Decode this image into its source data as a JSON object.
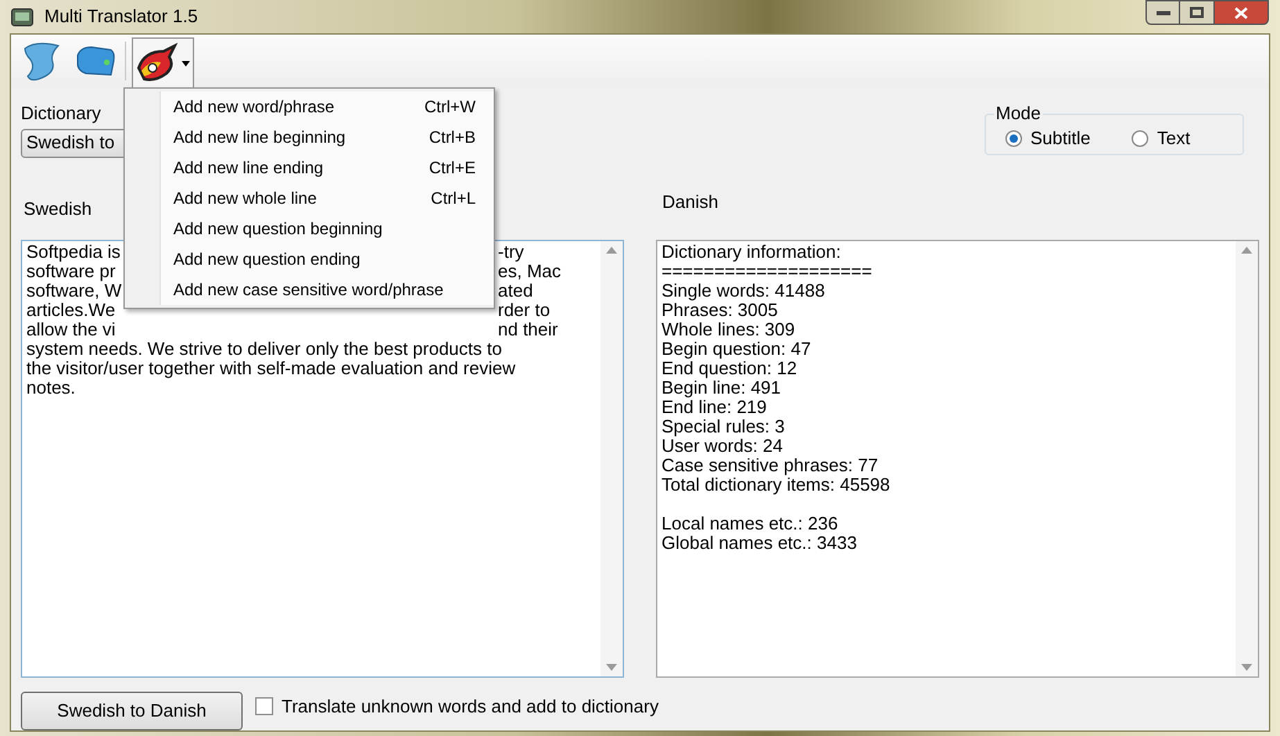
{
  "window": {
    "title": "Multi Translator 1.5"
  },
  "toolbar": {
    "dropdown": {
      "expanded": true
    }
  },
  "dictionary": {
    "label": "Dictionary",
    "value": "Swedish to"
  },
  "mode": {
    "label": "Mode",
    "options": [
      {
        "label": "Subtitle",
        "selected": true
      },
      {
        "label": "Text",
        "selected": false
      }
    ]
  },
  "source": {
    "label": "Swedish",
    "lines": [
      {
        "left": "Softpedia is",
        "right": "-try"
      },
      {
        "left": "software pr",
        "right": "es, Mac"
      },
      {
        "left": "software, W",
        "right": "ated"
      },
      {
        "left": "articles.We",
        "right": "rder to"
      },
      {
        "left": "allow the vi",
        "right": "nd their"
      },
      {
        "left": "system needs. We strive to deliver only the best products to"
      },
      {
        "left": "the visitor/user together with self-made evaluation and review"
      },
      {
        "left": "notes."
      }
    ]
  },
  "target": {
    "label": "Danish",
    "paragraphs": [
      [
        "Dictionary information:",
        "====================",
        "Single words: 41488",
        "Phrases: 3005",
        "Whole lines: 309",
        "Begin question: 47",
        "End question: 12",
        "Begin line: 491",
        "End line: 219",
        "Special rules: 3",
        "User words: 24",
        "Case sensitive phrases: 77",
        "Total dictionary items: 45598"
      ],
      [
        "Local names etc.: 236",
        "Global names etc.: 3433"
      ]
    ]
  },
  "translate_button": {
    "label": "Swedish to Danish"
  },
  "unknown_words": {
    "label": "Translate unknown words and add to dictionary",
    "checked": false
  },
  "menu": {
    "items": [
      {
        "label": "Add new word/phrase",
        "shortcut": "Ctrl+W"
      },
      {
        "label": "Add new line beginning",
        "shortcut": "Ctrl+B"
      },
      {
        "label": "Add new line ending",
        "shortcut": "Ctrl+E"
      },
      {
        "label": "Add new whole line",
        "shortcut": "Ctrl+L"
      },
      {
        "label": "Add new question beginning"
      },
      {
        "label": "Add new question ending"
      },
      {
        "label": "Add new case sensitive word/phrase"
      }
    ]
  }
}
